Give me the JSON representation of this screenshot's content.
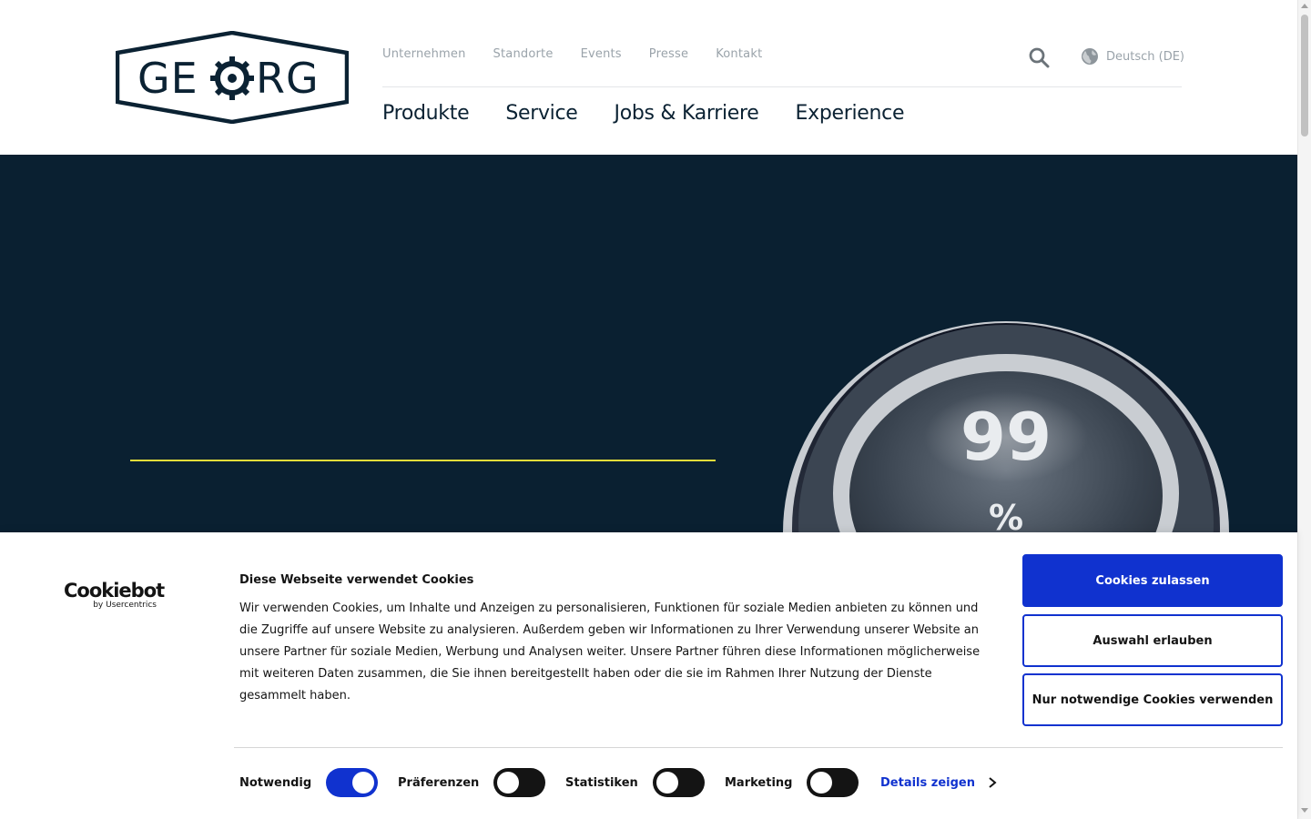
{
  "header": {
    "logo_text": "GEORG",
    "top_nav": [
      "Unternehmen",
      "Standorte",
      "Events",
      "Presse",
      "Kontakt"
    ],
    "language": "Deutsch (DE)",
    "main_nav": [
      "Produkte",
      "Service",
      "Jobs & Karriere",
      "Experience"
    ]
  },
  "hero": {
    "gauge_value": "99",
    "gauge_unit": "%",
    "accent_color": "#e2dc3a",
    "background_color": "#0a2031"
  },
  "cookie_banner": {
    "brand": "Cookiebot",
    "brand_sub": "by Usercentrics",
    "title": "Diese Webseite verwendet Cookies",
    "body": "Wir verwenden Cookies, um Inhalte und Anzeigen zu personalisieren, Funktionen für soziale Medien anbieten zu können und die Zugriffe auf unsere Website zu analysieren. Außerdem geben wir Informationen zu Ihrer Verwendung unserer Website an unsere Partner für soziale Medien, Werbung und Analysen weiter. Unsere Partner führen diese Informationen möglicherweise mit weiteren Daten zusammen, die Sie ihnen bereitgestellt haben oder die sie im Rahmen Ihrer Nutzung der Dienste gesammelt haben.",
    "buttons": {
      "allow_all": "Cookies zulassen",
      "allow_selection": "Auswahl erlauben",
      "necessary_only": "Nur notwendige Cookies verwenden"
    },
    "consents": [
      {
        "label": "Notwendig",
        "enabled": true
      },
      {
        "label": "Präferenzen",
        "enabled": false
      },
      {
        "label": "Statistiken",
        "enabled": false
      },
      {
        "label": "Marketing",
        "enabled": false
      }
    ],
    "details_label": "Details zeigen",
    "accent_color": "#1032cf"
  }
}
